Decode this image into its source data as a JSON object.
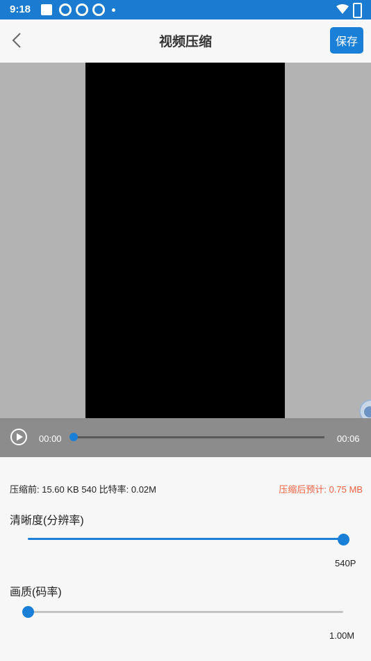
{
  "status_bar": {
    "time": "9:18",
    "icons": [
      "notification-square-icon",
      "sync-icon",
      "sync-icon",
      "sync-icon",
      "dot-icon",
      "wifi-icon",
      "battery-icon"
    ]
  },
  "header": {
    "title": "视频压缩",
    "save_label": "保存"
  },
  "player": {
    "current_time": "00:00",
    "duration": "00:06",
    "progress": 0
  },
  "info": {
    "before": "压缩前: 15.60 KB 540 比特率: 0.02M",
    "after_estimate": "压缩后预计: 0.75 MB"
  },
  "clarity": {
    "label": "清晰度(分辨率)",
    "value": "540P",
    "level": 1.0
  },
  "quality": {
    "label": "画质(码率)",
    "value": "1.00M",
    "level": 0.0
  },
  "colors": {
    "accent": "#1a7fd6",
    "status_bar": "#1b7bd0",
    "estimate": "#f0603f"
  }
}
